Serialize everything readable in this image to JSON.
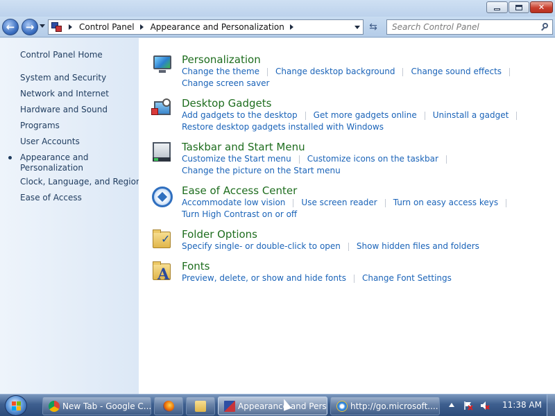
{
  "window": {
    "controls": {
      "minimize": "–",
      "maximize": "□",
      "close": "✕"
    }
  },
  "address": {
    "crumbs": [
      "Control Panel",
      "Appearance and Personalization"
    ],
    "search_placeholder": "Search Control Panel"
  },
  "sidebar": {
    "home": "Control Panel Home",
    "items": [
      "System and Security",
      "Network and Internet",
      "Hardware and Sound",
      "Programs",
      "User Accounts",
      "Appearance and",
      "Personalization",
      "Clock, Language, and Region",
      "Ease of Access"
    ],
    "current_item": "Appearance and Personalization"
  },
  "categories": [
    {
      "title": "Personalization",
      "icon": "personalization-icon",
      "row1": [
        "Change the theme",
        "Change desktop background",
        "Change sound effects"
      ],
      "row2": [
        "Change screen saver"
      ]
    },
    {
      "title": "Desktop Gadgets",
      "icon": "desktop-gadgets-icon",
      "row1": [
        "Add gadgets to the desktop",
        "Get more gadgets online",
        "Uninstall a gadget"
      ],
      "row2": [
        "Restore desktop gadgets installed with Windows"
      ]
    },
    {
      "title": "Taskbar and Start Menu",
      "icon": "taskbar-icon",
      "row1": [
        "Customize the Start menu",
        "Customize icons on the taskbar"
      ],
      "row2": [
        "Change the picture on the Start menu"
      ]
    },
    {
      "title": "Ease of Access Center",
      "icon": "ease-of-access-icon",
      "row1": [
        "Accommodate low vision",
        "Use screen reader",
        "Turn on easy access keys"
      ],
      "row2": [
        "Turn High Contrast on or off"
      ]
    },
    {
      "title": "Folder Options",
      "icon": "folder-options-icon",
      "row1": [
        "Specify single- or double-click to open",
        "Show hidden files and folders"
      ],
      "row2": []
    },
    {
      "title": "Fonts",
      "icon": "fonts-icon",
      "row1": [
        "Preview, delete, or show and hide fonts",
        "Change Font Settings"
      ],
      "row2": []
    }
  ],
  "taskbar": {
    "buttons": [
      {
        "label": "New Tab - Google C...",
        "icon": "chrome-icon"
      },
      {
        "label": "",
        "icon": "firefox-icon"
      },
      {
        "label": "",
        "icon": "explorer-folder-icon"
      },
      {
        "label": "Appearance and Pers...",
        "icon": "control-panel-icon",
        "active": true
      },
      {
        "label": "http://go.microsoft....",
        "icon": "internet-explorer-icon"
      }
    ],
    "clock": "11:38 AM"
  },
  "colors": {
    "link": "#1a63b8",
    "category_title": "#1e6d1e",
    "sidebar_text": "#1e3b5e",
    "taskbar": "#3e5f8f"
  }
}
